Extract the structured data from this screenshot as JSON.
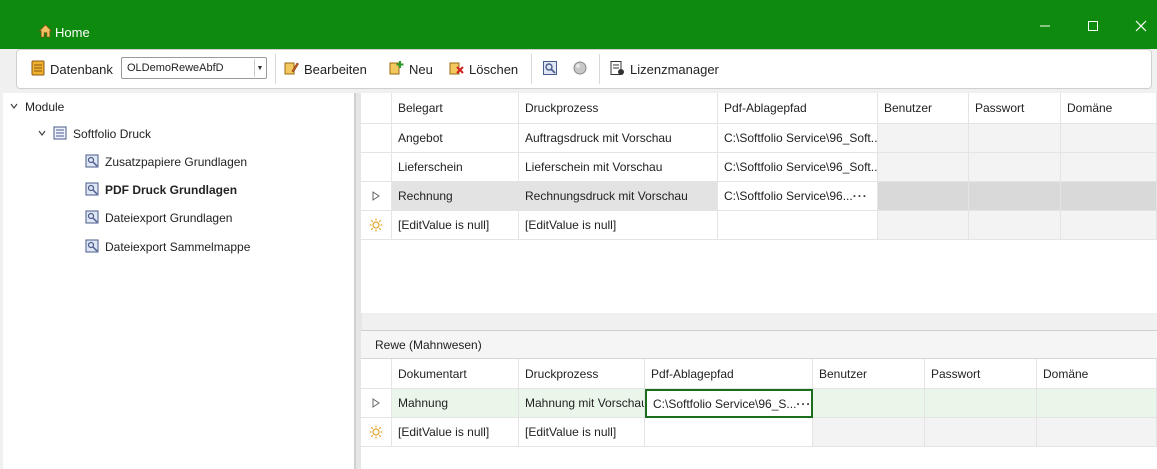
{
  "window": {
    "title": "Home"
  },
  "toolbar": {
    "datenbank_label": "Datenbank",
    "datenbank_value": "OLDemoReweAbfD",
    "bearbeiten_label": "Bearbeiten",
    "neu_label": "Neu",
    "loeschen_label": "Löschen",
    "lizenz_label": "Lizenzmanager"
  },
  "tree": {
    "root": "Module",
    "group": "Softfolio Druck",
    "items": [
      {
        "label": "Zusatzpapiere Grundlagen",
        "selected": false
      },
      {
        "label": "PDF Druck Grundlagen",
        "selected": true
      },
      {
        "label": "Dateiexport Grundlagen",
        "selected": false
      },
      {
        "label": "Dateiexport Sammelmappe",
        "selected": false
      }
    ]
  },
  "grid1": {
    "columns": [
      "Belegart",
      "Druckprozess",
      "Pdf-Ablagepfad",
      "Benutzer",
      "Passwort",
      "Domäne"
    ],
    "rows": [
      [
        "Angebot",
        "Auftragsdruck mit Vorschau",
        "C:\\Softfolio Service\\96_Soft...",
        "",
        "",
        ""
      ],
      [
        "Lieferschein",
        "Lieferschein mit Vorschau",
        "C:\\Softfolio Service\\96_Soft...",
        "",
        "",
        ""
      ],
      [
        "Rechnung",
        "Rechnungsdruck mit Vorschau",
        "C:\\Softfolio Service\\96...",
        "",
        "",
        ""
      ],
      [
        "[EditValue is null]",
        "[EditValue is null]",
        "",
        "",
        "",
        ""
      ]
    ],
    "ellipsis": "···"
  },
  "grid2": {
    "group_title": "Rewe (Mahnwesen)",
    "columns": [
      "Dokumentart",
      "Druckprozess",
      "Pdf-Ablagepfad",
      "Benutzer",
      "Passwort",
      "Domäne"
    ],
    "rows": [
      [
        "Mahnung",
        "Mahnung mit Vorschau",
        "C:\\Softfolio Service\\96_S...",
        "",
        "",
        ""
      ],
      [
        "[EditValue is null]",
        "[EditValue is null]",
        "",
        "",
        "",
        ""
      ]
    ],
    "ellipsis": "···"
  },
  "colors": {
    "titlebar": "#0e8a0e",
    "focus_border": "#1b6e1b"
  }
}
